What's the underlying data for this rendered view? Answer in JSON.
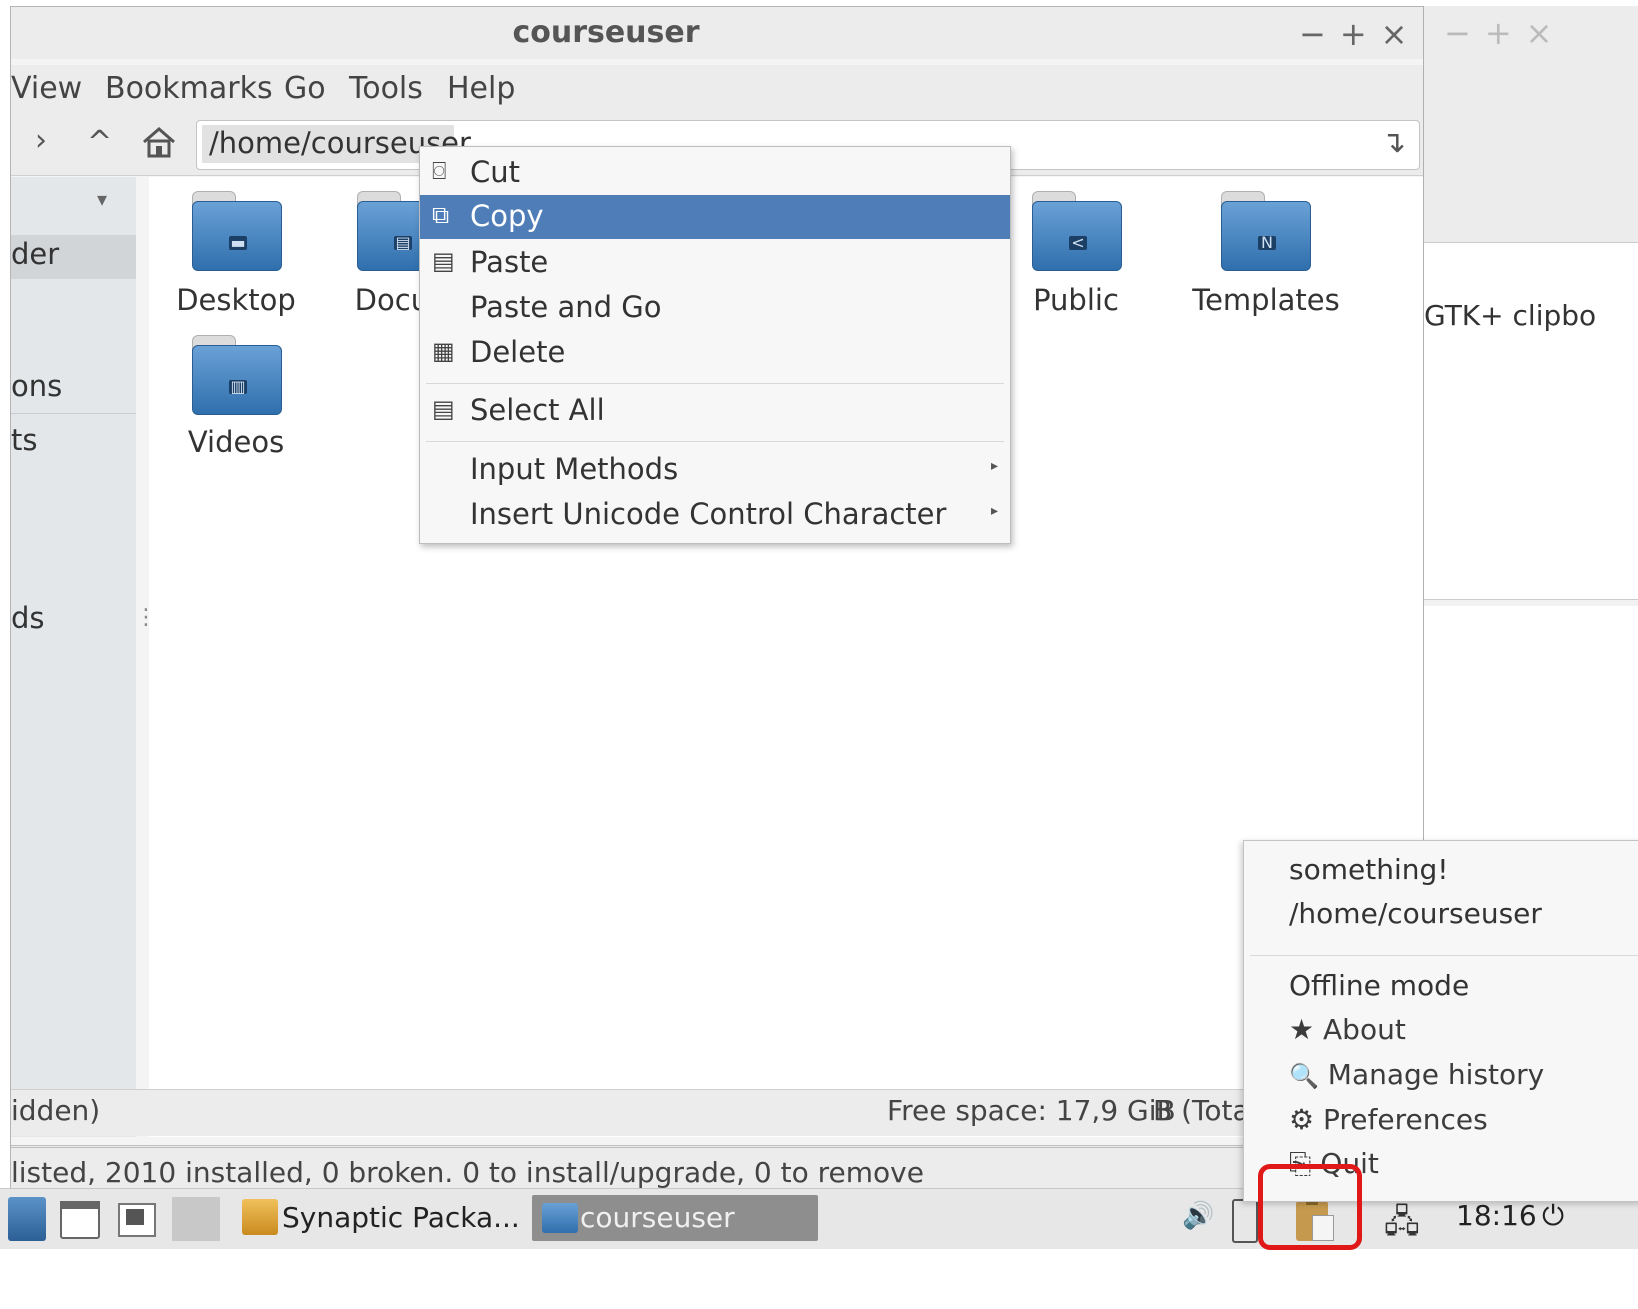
{
  "window": {
    "title": "courseuser",
    "controls": {
      "minimize": "−",
      "maximize": "+",
      "close": "×"
    }
  },
  "right_window": {
    "controls": {
      "minimize": "−",
      "maximize": "+",
      "close": "×"
    },
    "text": "GTK+ clipbo"
  },
  "menubar": [
    "View",
    "Bookmarks",
    "Go",
    "Tools",
    "Help"
  ],
  "toolbar": {
    "path": "/home/courseuser",
    "forward": "›",
    "up": "^",
    "go": "↴"
  },
  "sidebar": {
    "items": [
      "der",
      "ons",
      "ts",
      "ds"
    ],
    "dropdown": "▾",
    "handle": "⋮"
  },
  "folders": [
    {
      "label": "Desktop",
      "emblem": "▬"
    },
    {
      "label": "Docum",
      "emblem": "▤"
    },
    {
      "label": "Public",
      "emblem": "<"
    },
    {
      "label": "Templates",
      "emblem": "N"
    },
    {
      "label": "Videos",
      "emblem": "▥"
    }
  ],
  "context_menu": {
    "items": [
      {
        "label": "Cut",
        "icon": "cut-icon",
        "glyph": "⌼"
      },
      {
        "label": "Copy",
        "icon": "copy-icon",
        "glyph": "⧉",
        "selected": true
      },
      {
        "label": "Paste",
        "icon": "paste-icon",
        "glyph": "▤"
      },
      {
        "label": "Paste and Go"
      },
      {
        "label": "Delete",
        "icon": "delete-icon",
        "glyph": "▦"
      },
      {
        "label": "Select All",
        "icon": "select-all-icon",
        "glyph": "▤"
      },
      {
        "label": "Input Methods",
        "submenu": true
      },
      {
        "label": "Insert Unicode Control Character",
        "submenu": true
      }
    ]
  },
  "status": {
    "hidden": "idden)",
    "free_space": "Free space: 17,9 GiB",
    "total": "B (Tota",
    "packages": "listed, 2010 installed, 0 broken. 0 to install/upgrade, 0 to remove"
  },
  "clipboard_popup": {
    "history": [
      "something!",
      "/home/courseuser"
    ],
    "offline": "Offline mode",
    "about": "About",
    "manage": "Manage history",
    "prefs": "Preferences",
    "quit": "Quit",
    "icons": {
      "about": "★",
      "manage": "🔍",
      "prefs": "⚙",
      "quit": "⎘"
    }
  },
  "taskbar": {
    "tasks": [
      "Synaptic Packa...",
      "courseuser"
    ],
    "clock": "18:16",
    "volume": "🔊",
    "network": "🖧",
    "power": "⏻"
  },
  "colors": {
    "selection": "#4f7db8",
    "highlight": "#e01818",
    "folder": "#3b7bbf"
  }
}
